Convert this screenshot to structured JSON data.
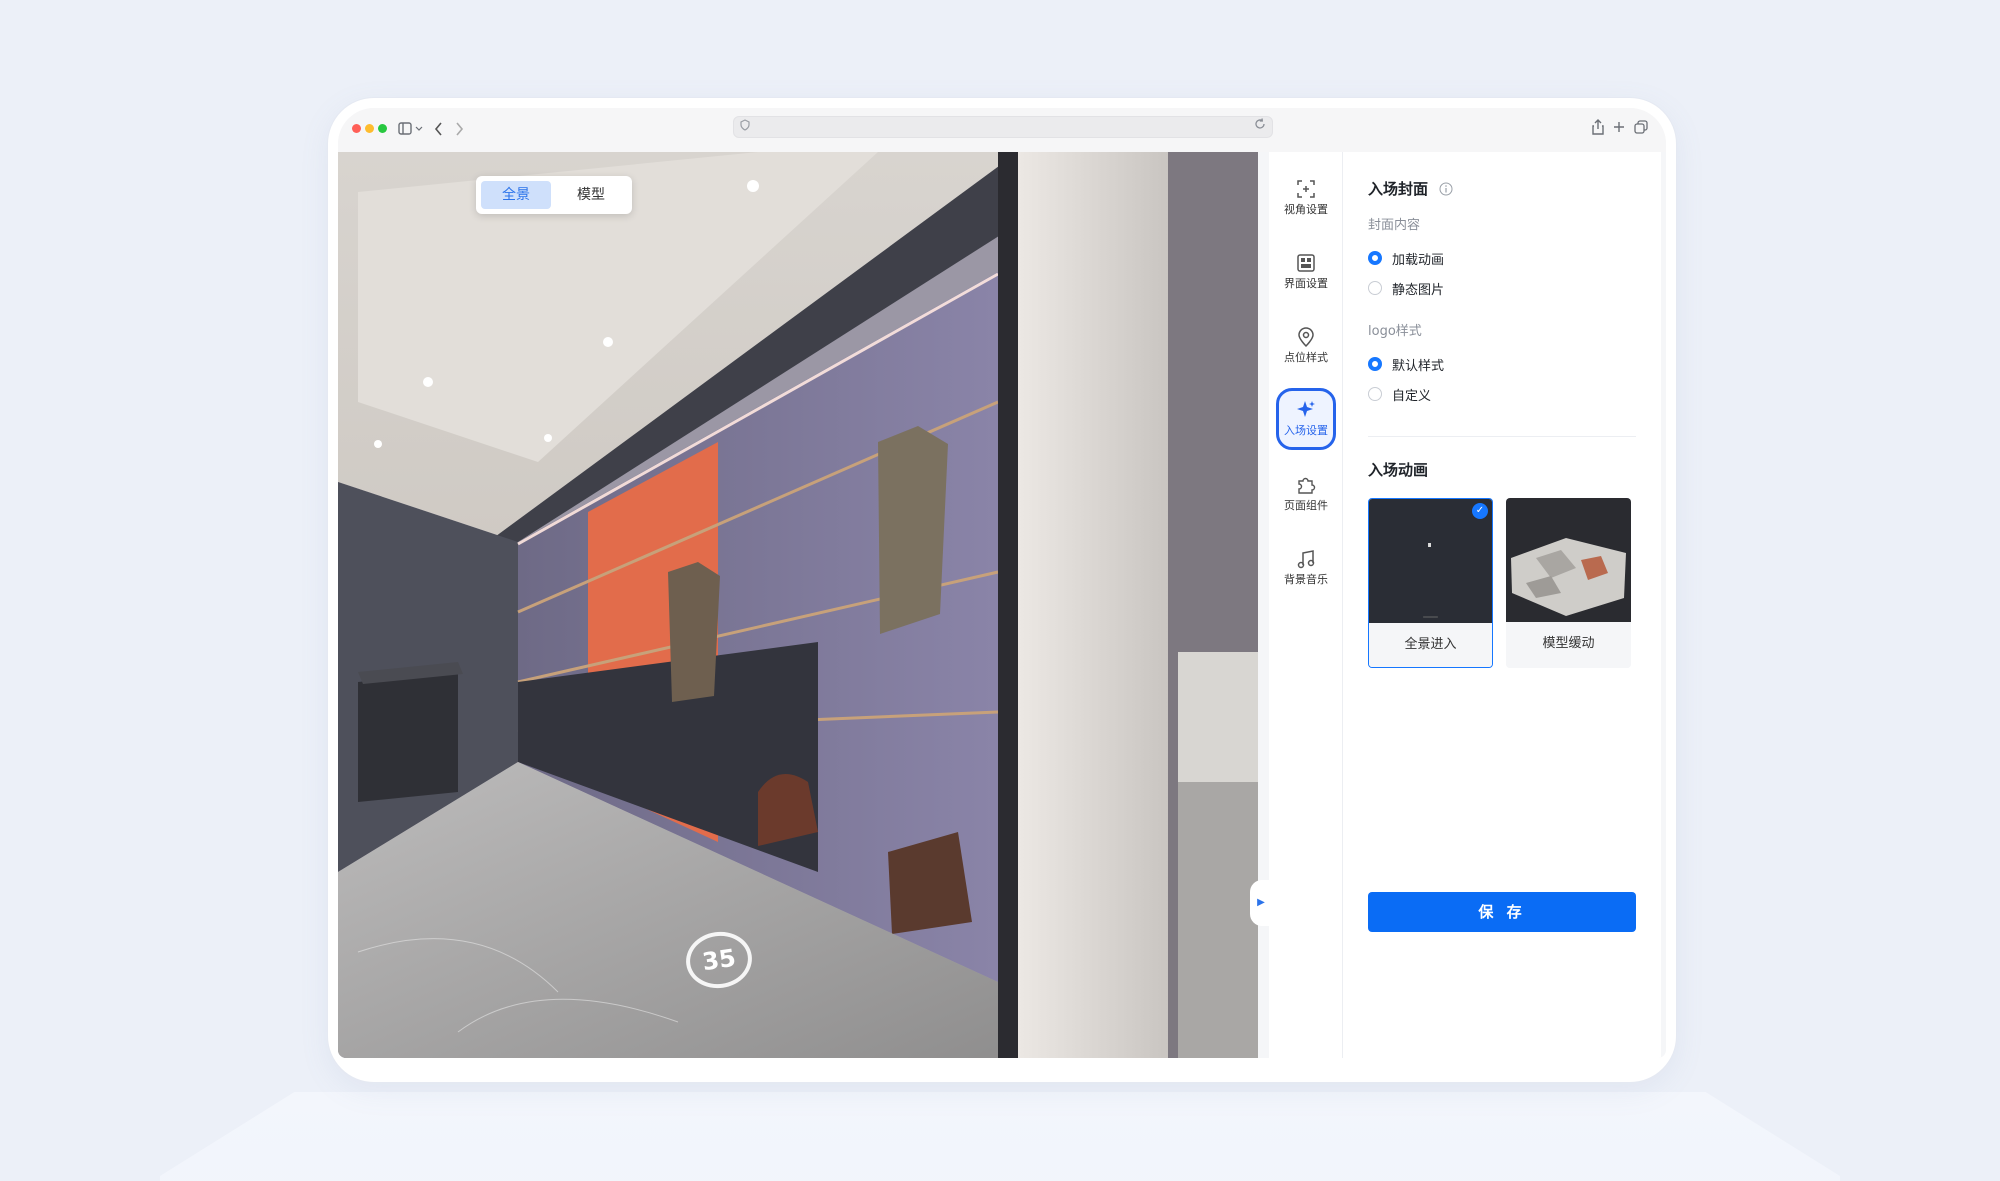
{
  "viewer": {
    "toggle": {
      "panorama": "全景",
      "model": "模型"
    },
    "floor_marker": "35"
  },
  "side_nav": [
    {
      "label": "视角设置",
      "icon": "viewpoint-icon"
    },
    {
      "label": "界面设置",
      "icon": "layout-icon"
    },
    {
      "label": "点位样式",
      "icon": "location-pin-icon"
    },
    {
      "label": "入场设置",
      "icon": "sparkle-icon",
      "active": true
    },
    {
      "label": "页面组件",
      "icon": "puzzle-icon"
    },
    {
      "label": "背景音乐",
      "icon": "music-note-icon"
    }
  ],
  "panel": {
    "cover_title": "入场封面",
    "cover_content_label": "封面内容",
    "cover_options": [
      "加载动画",
      "静态图片"
    ],
    "cover_selected": 0,
    "logo_label": "logo样式",
    "logo_options": [
      "默认样式",
      "自定义"
    ],
    "logo_selected": 0,
    "anim_title": "入场动画",
    "anim_cards": [
      {
        "label": "全景进入",
        "selected": true
      },
      {
        "label": "模型缓动",
        "selected": false
      }
    ],
    "save_label": "保 存"
  },
  "colors": {
    "accent": "#1677ff",
    "save": "#0a6cf5",
    "bg": "#ecf0f8"
  }
}
